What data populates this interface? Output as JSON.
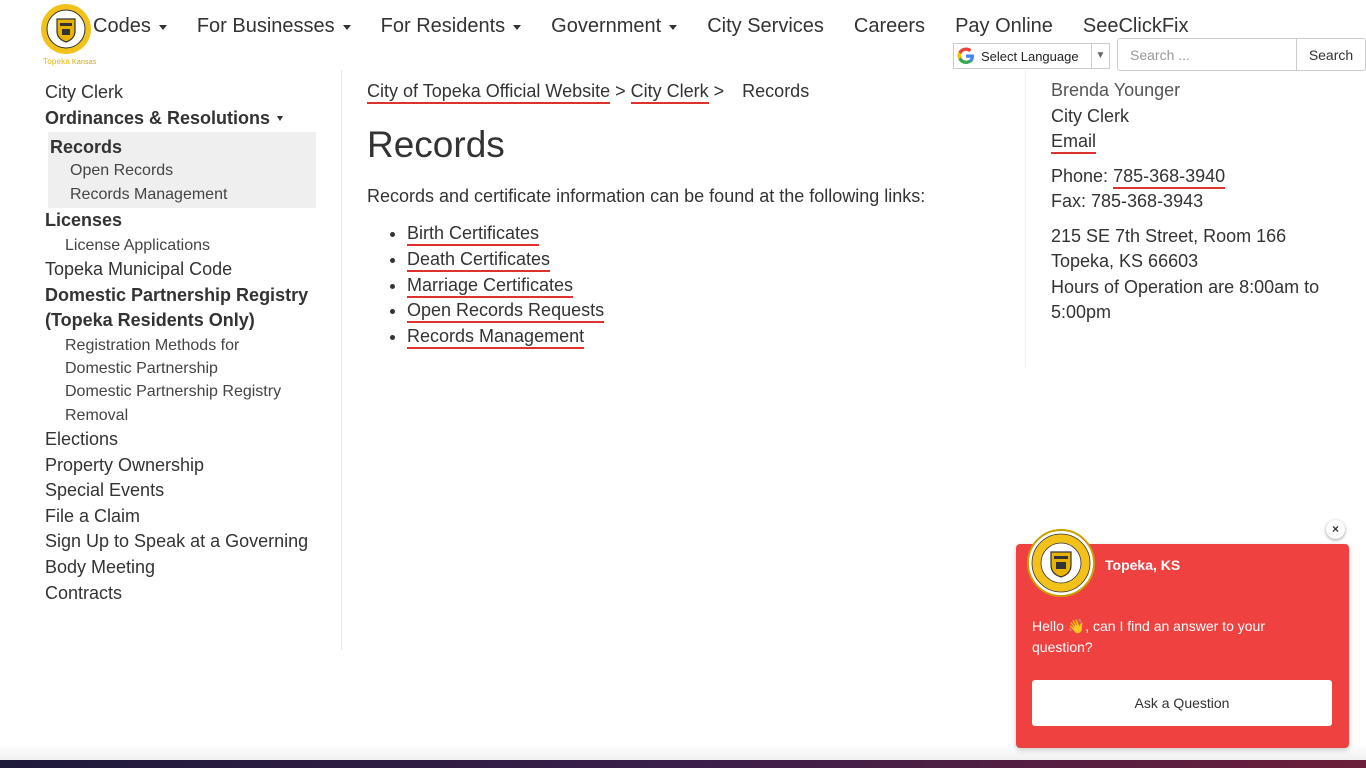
{
  "header": {
    "logo_text": "Topeka",
    "logo_subtext": "Kansas",
    "nav": [
      {
        "label": "Codes",
        "dropdown": true
      },
      {
        "label": "For Businesses",
        "dropdown": true
      },
      {
        "label": "For Residents",
        "dropdown": true
      },
      {
        "label": "Government",
        "dropdown": true
      },
      {
        "label": "City Services",
        "dropdown": false
      },
      {
        "label": "Careers",
        "dropdown": false
      },
      {
        "label": "Pay Online",
        "dropdown": false
      },
      {
        "label": "SeeClickFix",
        "dropdown": false
      }
    ],
    "translate_label": "Select Language",
    "search_placeholder": "Search ...",
    "search_button": "Search"
  },
  "sidebar": {
    "city_clerk": "City Clerk",
    "ordinances": "Ordinances & Resolutions",
    "records": "Records",
    "open_records": "Open Records",
    "records_management": "Records Management",
    "licenses": "Licenses",
    "license_applications": "License Applications",
    "municipal_code": "Topeka Municipal Code",
    "domestic_registry_1": "Domestic Partnership Registry",
    "domestic_registry_2": "(Topeka Residents Only)",
    "registration_methods_1": "Registration Methods for",
    "registration_methods_2": "Domestic Partnership",
    "registry_removal_1": "Domestic Partnership Registry",
    "registry_removal_2": "Removal",
    "elections": "Elections",
    "property_ownership": "Property Ownership",
    "special_events": "Special Events",
    "file_claim": "File a Claim",
    "sign_up_1": "Sign Up to Speak at a Governing",
    "sign_up_2": "Body Meeting",
    "contracts": "Contracts"
  },
  "breadcrumb": {
    "home": "City of Topeka Official Website",
    "sep": ">",
    "parent": "City Clerk",
    "current": "Records"
  },
  "main": {
    "title": "Records",
    "intro": "Records and certificate information can be found at the following links:",
    "links": [
      "Birth Certificates",
      "Death Certificates",
      "Marriage Certificates",
      "Open Records Requests",
      "Records Management"
    ]
  },
  "contact": {
    "name": "Brenda Younger",
    "role": "City Clerk",
    "email_label": "Email",
    "phone_label": "Phone:",
    "phone": "785-368-3940",
    "fax": "Fax: 785-368-3943",
    "address_1": "215 SE 7th Street, Room 166",
    "address_2": "Topeka, KS 66603",
    "hours_1": "Hours of Operation are 8:00am to",
    "hours_2": "5:00pm"
  },
  "chat": {
    "close": "×",
    "name": "Topeka, KS",
    "message_1": "Hello ",
    "wave": "👋",
    "message_2": ", can I find an answer to your question?",
    "ask_button": "Ask a Question"
  },
  "colors": {
    "link_underline": "#e03131",
    "chat_bg": "#f04141",
    "seal_gold": "#e8b400"
  }
}
